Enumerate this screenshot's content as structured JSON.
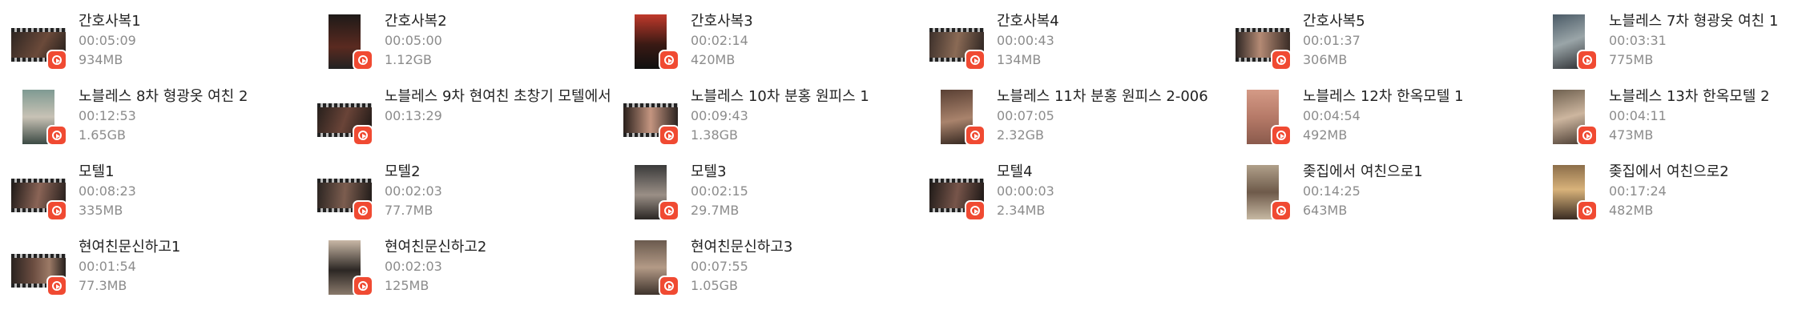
{
  "files": [
    {
      "name": "간호사복1",
      "duration": "00:05:09",
      "size": "934MB"
    },
    {
      "name": "간호사복2",
      "duration": "00:05:00",
      "size": "1.12GB"
    },
    {
      "name": "간호사복3",
      "duration": "00:02:14",
      "size": "420MB"
    },
    {
      "name": "간호사복4",
      "duration": "00:00:43",
      "size": "134MB"
    },
    {
      "name": "간호사복5",
      "duration": "00:01:37",
      "size": "306MB"
    },
    {
      "name": "노블레스 7차 형광옷 여친 1",
      "duration": "00:03:31",
      "size": "775MB"
    },
    {
      "name": "노블레스 8차 형광옷 여친 2",
      "duration": "00:12:53",
      "size": "1.65GB"
    },
    {
      "name": "노블레스 9차 현여친 초창기 모텔에서",
      "duration": "00:13:29",
      "size": ""
    },
    {
      "name": "노블레스 10차 분홍 원피스 1",
      "duration": "00:09:43",
      "size": "1.38GB"
    },
    {
      "name": "노블레스 11차 분홍 원피스 2-006",
      "duration": "00:07:05",
      "size": "2.32GB"
    },
    {
      "name": "노블레스 12차 한옥모텔 1",
      "duration": "00:04:54",
      "size": "492MB"
    },
    {
      "name": "노블레스 13차 한옥모텔 2",
      "duration": "00:04:11",
      "size": "473MB"
    },
    {
      "name": "모텔1",
      "duration": "00:08:23",
      "size": "335MB"
    },
    {
      "name": "모텔2",
      "duration": "00:02:03",
      "size": "77.7MB"
    },
    {
      "name": "모텔3",
      "duration": "00:02:15",
      "size": "29.7MB"
    },
    {
      "name": "모텔4",
      "duration": "00:00:03",
      "size": "2.34MB"
    },
    {
      "name": "좆집에서 여친으로1",
      "duration": "00:14:25",
      "size": "643MB"
    },
    {
      "name": "좆집에서 여친으로2",
      "duration": "00:17:24",
      "size": "482MB"
    },
    {
      "name": "현여친문신하고1",
      "duration": "00:01:54",
      "size": "77.3MB"
    },
    {
      "name": "현여친문신하고2",
      "duration": "00:02:03",
      "size": "125MB"
    },
    {
      "name": "현여친문신하고3",
      "duration": "00:07:55",
      "size": "1.05GB"
    }
  ]
}
